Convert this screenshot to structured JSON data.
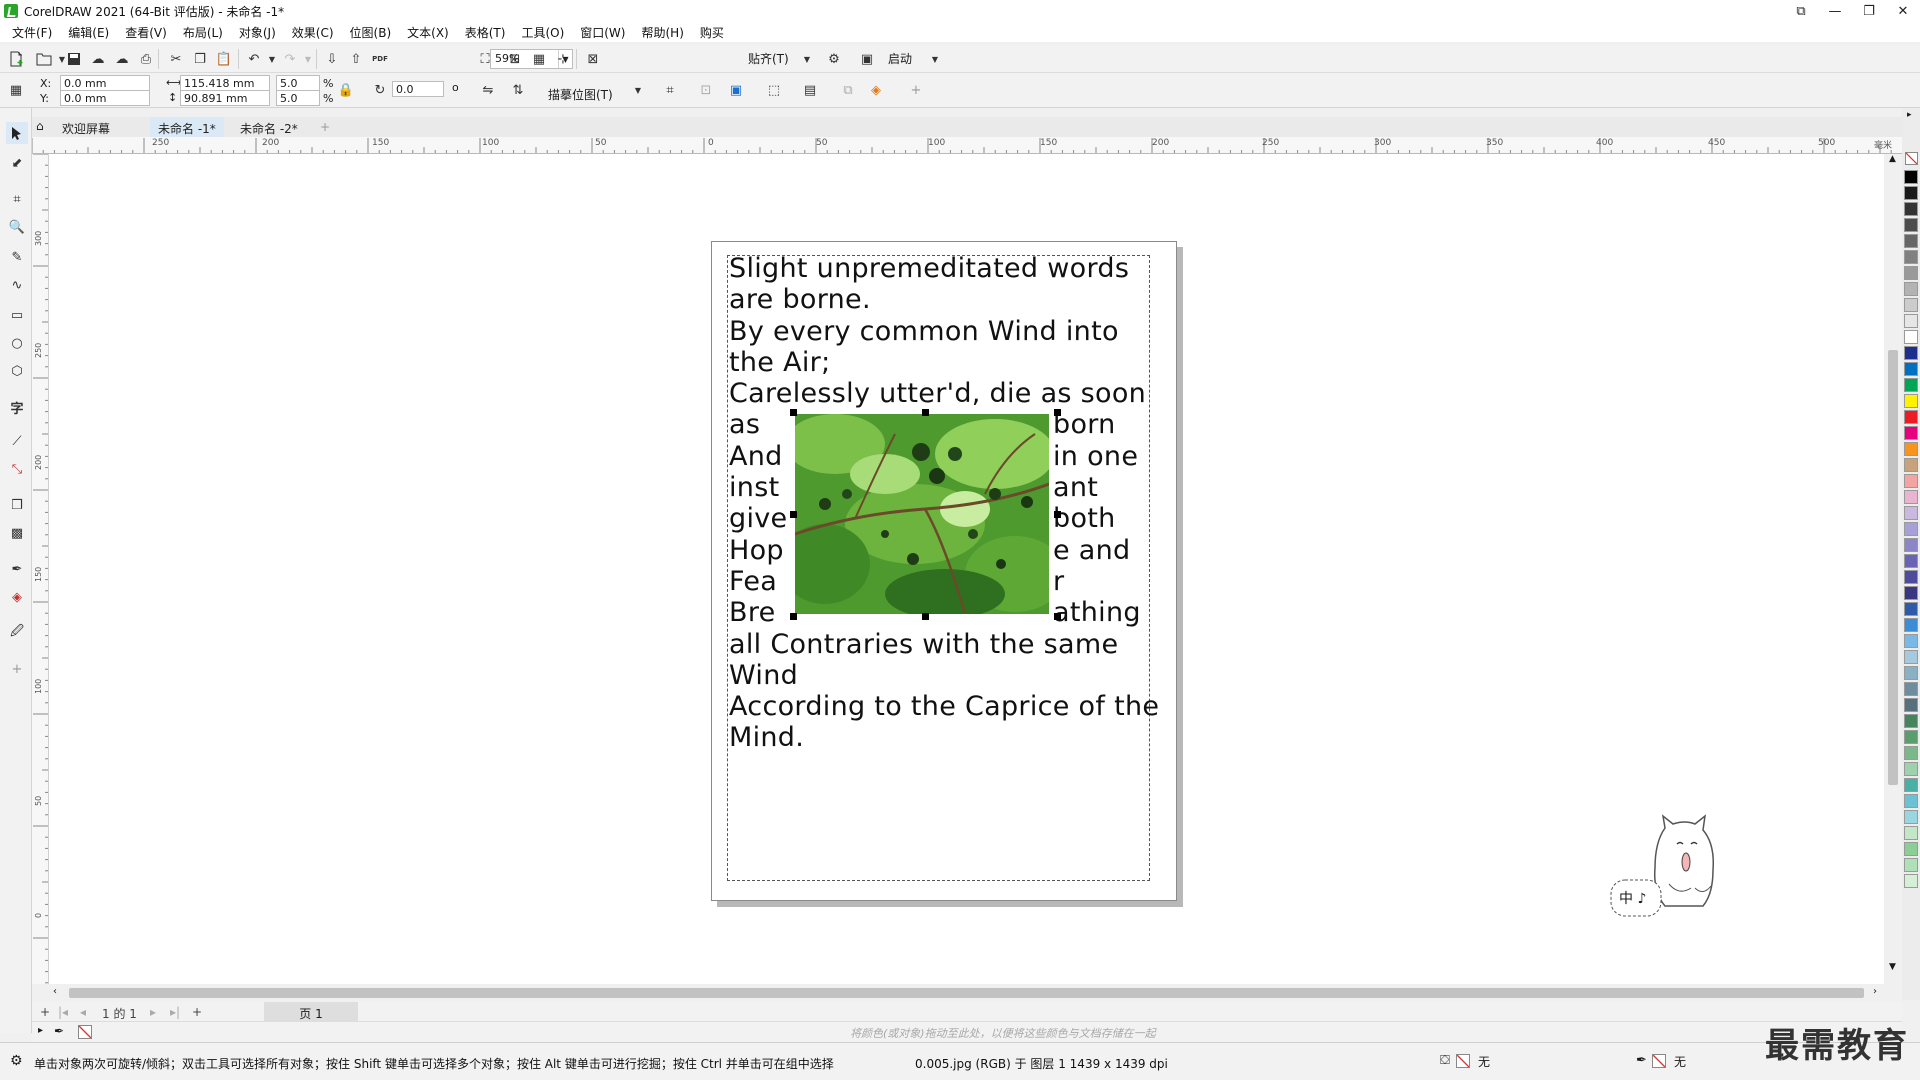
{
  "window": {
    "title": "CorelDRAW 2021 (64-Bit 评估版) - 未命名 -1*",
    "controls": [
      "⧉",
      "—",
      "❐",
      "✕"
    ]
  },
  "menu": [
    "文件(F)",
    "编辑(E)",
    "查看(V)",
    "布局(L)",
    "对象(J)",
    "效果(C)",
    "位图(B)",
    "文本(X)",
    "表格(T)",
    "工具(O)",
    "窗口(W)",
    "帮助(H)",
    "购买"
  ],
  "toolbar": {
    "zoom": "59%",
    "snap_label": "贴齐(T)",
    "launch_label": "启动",
    "pdf_label": "PDF"
  },
  "properties": {
    "x_label": "X:",
    "y_label": "Y:",
    "x": "0.0 mm",
    "y": "0.0 mm",
    "width": "115.418 mm",
    "height": "90.891 mm",
    "scale_w": "5.0",
    "scale_h": "5.0",
    "percent": "%",
    "angle": "0.0",
    "degree": "o",
    "trace_label": "描摹位图(T)"
  },
  "tabs": {
    "welcome": "欢迎屏幕",
    "doc1": "未命名 -1*",
    "doc2": "未命名 -2*",
    "add": "+"
  },
  "ruler": {
    "h_labels": [
      "250",
      "200",
      "150",
      "100",
      "50",
      "0",
      "50",
      "100",
      "150",
      "200",
      "250",
      "300",
      "350",
      "400",
      "450",
      "500"
    ],
    "v_labels": [
      "300",
      "250",
      "200",
      "150",
      "100",
      "50",
      "0"
    ],
    "units": "毫米"
  },
  "poem": {
    "full_lines": [
      "Slight unpremeditated words",
      "are borne.",
      "By every common Wind into",
      "the Air;",
      "Carelessly utter'd, die as soon"
    ],
    "wrap_left": [
      "as",
      "And",
      "inst",
      "give",
      "Hop",
      "Fea",
      "Bre"
    ],
    "wrap_right": [
      "born",
      "in one",
      "ant",
      "both",
      "e and",
      "r",
      "athing"
    ],
    "tail_lines": [
      "all Contraries with the same",
      "Wind",
      "According to the Caprice of the",
      "Mind."
    ]
  },
  "mascot": {
    "label": "中 ♪"
  },
  "pagenav": {
    "page_of": "1 的 1",
    "page_tab": "页 1"
  },
  "color_hint": "将颜色(或对象)拖动至此处，以便将这些颜色与文档存储在一起",
  "status": {
    "hint": "单击对象两次可旋转/倾斜；双击工具可选择所有对象；按住 Shift 键单击可选择多个对象；按住 Alt 键单击可进行挖掘；按住 Ctrl 并单击可在组中选择",
    "file_info": "0.005.jpg (RGB) 于 图层 1 1439 x 1439 dpi",
    "fill_none": "无",
    "outline_none": "无"
  },
  "watermark": "最需教育",
  "colors": {
    "accent": "#2aa52a",
    "tab_active": "#dbe9f7",
    "palette": [
      "#000000",
      "#1a1a1a",
      "#333333",
      "#4d4d4d",
      "#666666",
      "#808080",
      "#999999",
      "#b3b3b3",
      "#cccccc",
      "#e6e6e6",
      "#ffffff",
      "#1f2e8c",
      "#0070c0",
      "#00a651",
      "#fff200",
      "#ed1c24",
      "#e6007e",
      "#f7941d",
      "#c8a27a",
      "#f4a3a3",
      "#e8b4d0",
      "#c9b8e0",
      "#a6a0d6",
      "#8c86c8",
      "#6a63b5",
      "#4e4a9e",
      "#3a3680",
      "#2e5aa8",
      "#3c8dd6",
      "#7ab8e6",
      "#a7c9dd",
      "#8ab0c4",
      "#6e8ea0",
      "#56707e",
      "#46845e",
      "#5a9e6e",
      "#7ab88a",
      "#9fd1ae",
      "#4ab0a6",
      "#6ac2d4",
      "#9ad6df",
      "#c4e6c8",
      "#8ccf96",
      "#b0e0b8",
      "#d6f0d6"
    ]
  }
}
